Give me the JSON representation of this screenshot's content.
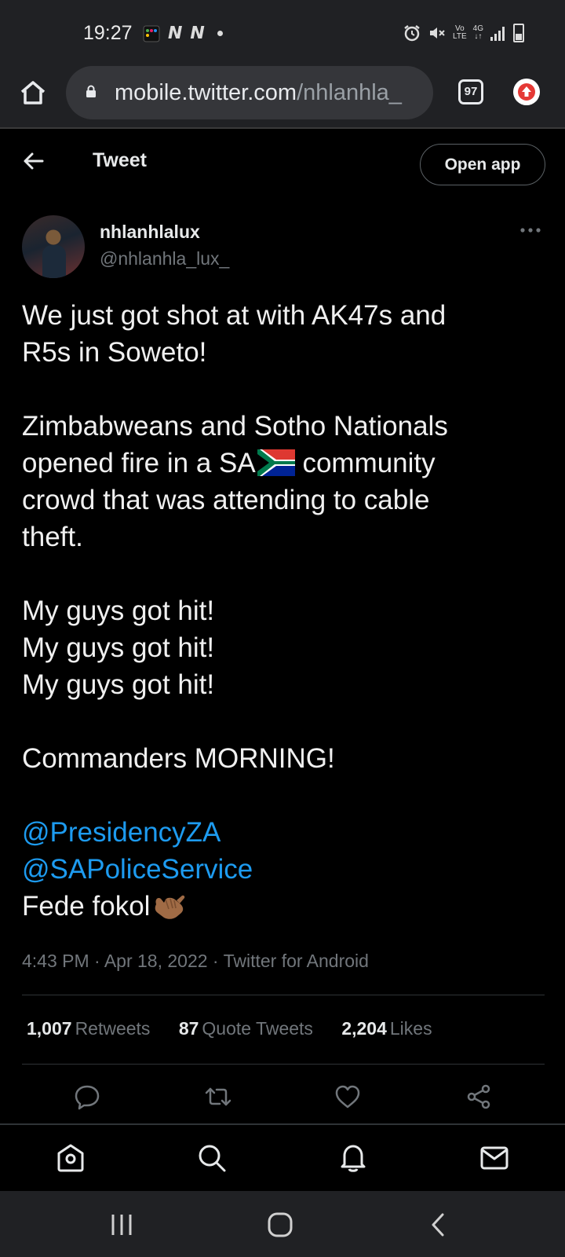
{
  "status_bar": {
    "time": "19:27",
    "left_icons": [
      "media-app-icon",
      "n-icon",
      "n-icon",
      "dot-icon"
    ],
    "right_icons": [
      "alarm-icon",
      "mute-icon",
      "volte-icon",
      "4g-icon",
      "signal-icon",
      "battery-icon"
    ],
    "volte_label_top": "Vo",
    "volte_label_bottom": "LTE",
    "network_label": "4G"
  },
  "browser": {
    "url_host": "mobile.twitter.com",
    "url_path": "/nhlanhla_",
    "tab_count": "97",
    "update_color": "#e53935"
  },
  "header": {
    "title": "Tweet",
    "open_app_label": "Open app"
  },
  "author": {
    "name": "nhlanhlalux",
    "handle": "@nhlanhla_lux_"
  },
  "tweet": {
    "line1": "We just got shot at with AK47s and",
    "line2": "R5s in Soweto!",
    "line3": "Zimbabweans and Sotho Nationals",
    "line4_before": "opened fire in a SA",
    "line4_after": " community",
    "line5": "crowd that was attending to cable",
    "line6": "theft.",
    "line7": "My guys got hit!",
    "line8": "My guys got hit!",
    "line9": "My guys got hit!",
    "line10": "Commanders MORNING!",
    "mention1": "@PresidencyZA",
    "mention2": "@SAPoliceService",
    "line11": "Fede fokol",
    "emojis": [
      "south-africa-flag",
      "call-me-hand-medium-dark-skin"
    ]
  },
  "meta": {
    "time": "4:43 PM",
    "date": "Apr 18, 2022",
    "source": "Twitter for Android",
    "separator": " · "
  },
  "stats": {
    "retweets_count": "1,007",
    "retweets_label": "Retweets",
    "quotes_count": "87",
    "quotes_label": "Quote Tweets",
    "likes_count": "2,204",
    "likes_label": "Likes"
  },
  "colors": {
    "background": "#000000",
    "text": "#e7e9ea",
    "muted": "#71767b",
    "link": "#1d9bf0",
    "chrome": "#202124"
  }
}
